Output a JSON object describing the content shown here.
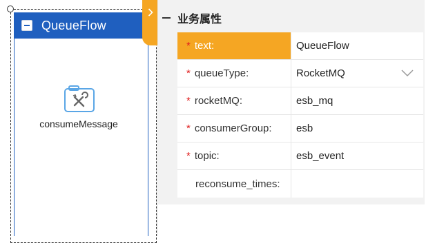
{
  "node": {
    "title": "QueueFlow",
    "task_label": "consumeMessage"
  },
  "panel": {
    "group_title": "业务属性",
    "properties": [
      {
        "label": "text:",
        "value": "QueueFlow"
      },
      {
        "label": "queueType:",
        "value": "RocketMQ"
      },
      {
        "label": "rocketMQ:",
        "value": "esb_mq"
      },
      {
        "label": "consumerGroup:",
        "value": "esb"
      },
      {
        "label": "topic:",
        "value": "esb_event"
      },
      {
        "label": "reconsume_times:",
        "value": ""
      }
    ],
    "required_marker": "*"
  },
  "colors": {
    "node_header": "#1f5fbf",
    "active_row": "#f5a623",
    "required": "#e02020"
  },
  "icons": {
    "collapse": "minus-icon",
    "task": "tools-briefcase-icon",
    "toggle": "chevron-right-icon",
    "dropdown": "chevron-down-icon"
  }
}
